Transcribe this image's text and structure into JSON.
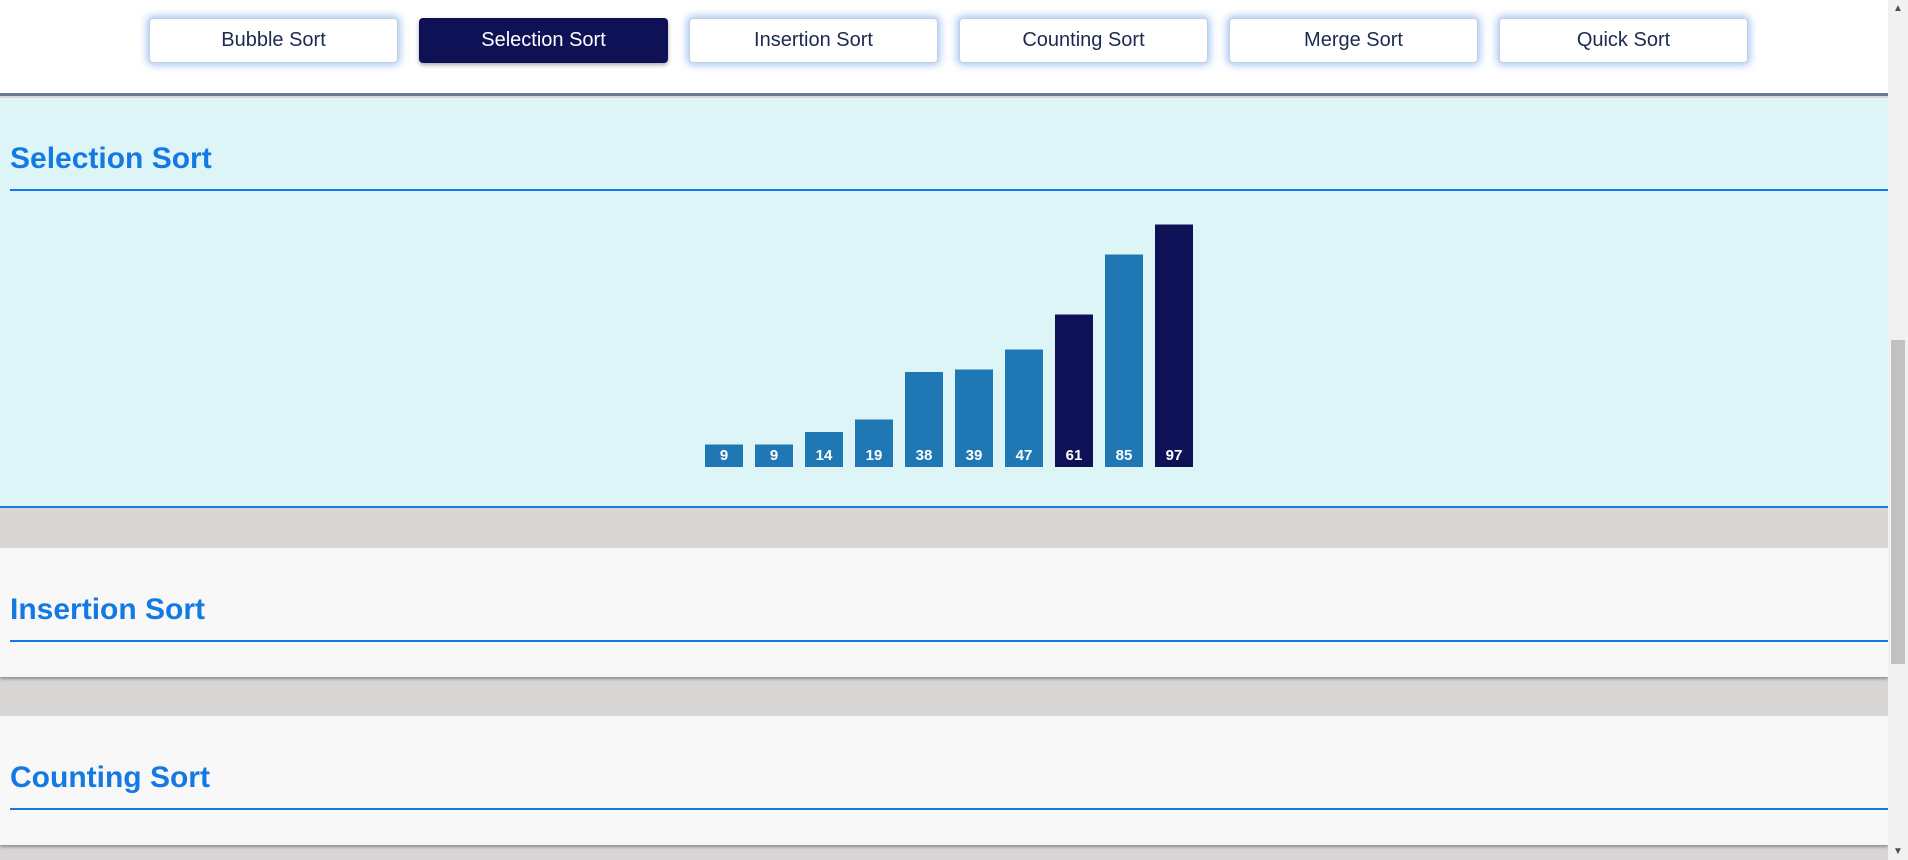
{
  "nav": {
    "buttons": [
      {
        "label": "Bubble Sort",
        "active": false
      },
      {
        "label": "Selection Sort",
        "active": true
      },
      {
        "label": "Insertion Sort",
        "active": false
      },
      {
        "label": "Counting Sort",
        "active": false
      },
      {
        "label": "Merge Sort",
        "active": false
      },
      {
        "label": "Quick Sort",
        "active": false
      }
    ]
  },
  "sections": {
    "selection": {
      "title": "Selection Sort"
    },
    "insertion": {
      "title": "Insertion Sort"
    },
    "counting": {
      "title": "Counting Sort"
    }
  },
  "colors": {
    "accent": "#1479e3",
    "bar_default": "#1f78b4",
    "bar_highlight": "#0f1156",
    "active_button": "#0f1156"
  },
  "chart_data": {
    "type": "bar",
    "values": [
      9,
      9,
      14,
      19,
      38,
      39,
      47,
      61,
      85,
      97
    ],
    "highlighted_indices": [
      7,
      9
    ]
  }
}
